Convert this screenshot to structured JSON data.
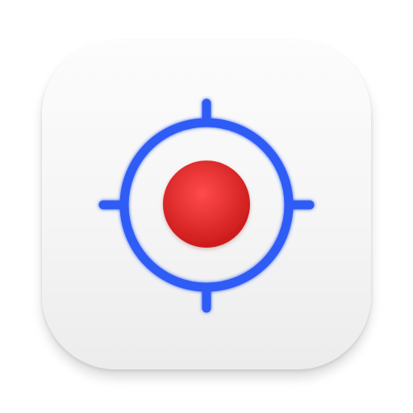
{
  "icon": {
    "semantic": "crosshair-target-app-icon",
    "colors": {
      "tile_top": "#fcfcfc",
      "tile_bottom": "#ececec",
      "ring": "#2f5cf5",
      "dot_light": "#ff4a4a",
      "dot_dark": "#c81818"
    }
  }
}
